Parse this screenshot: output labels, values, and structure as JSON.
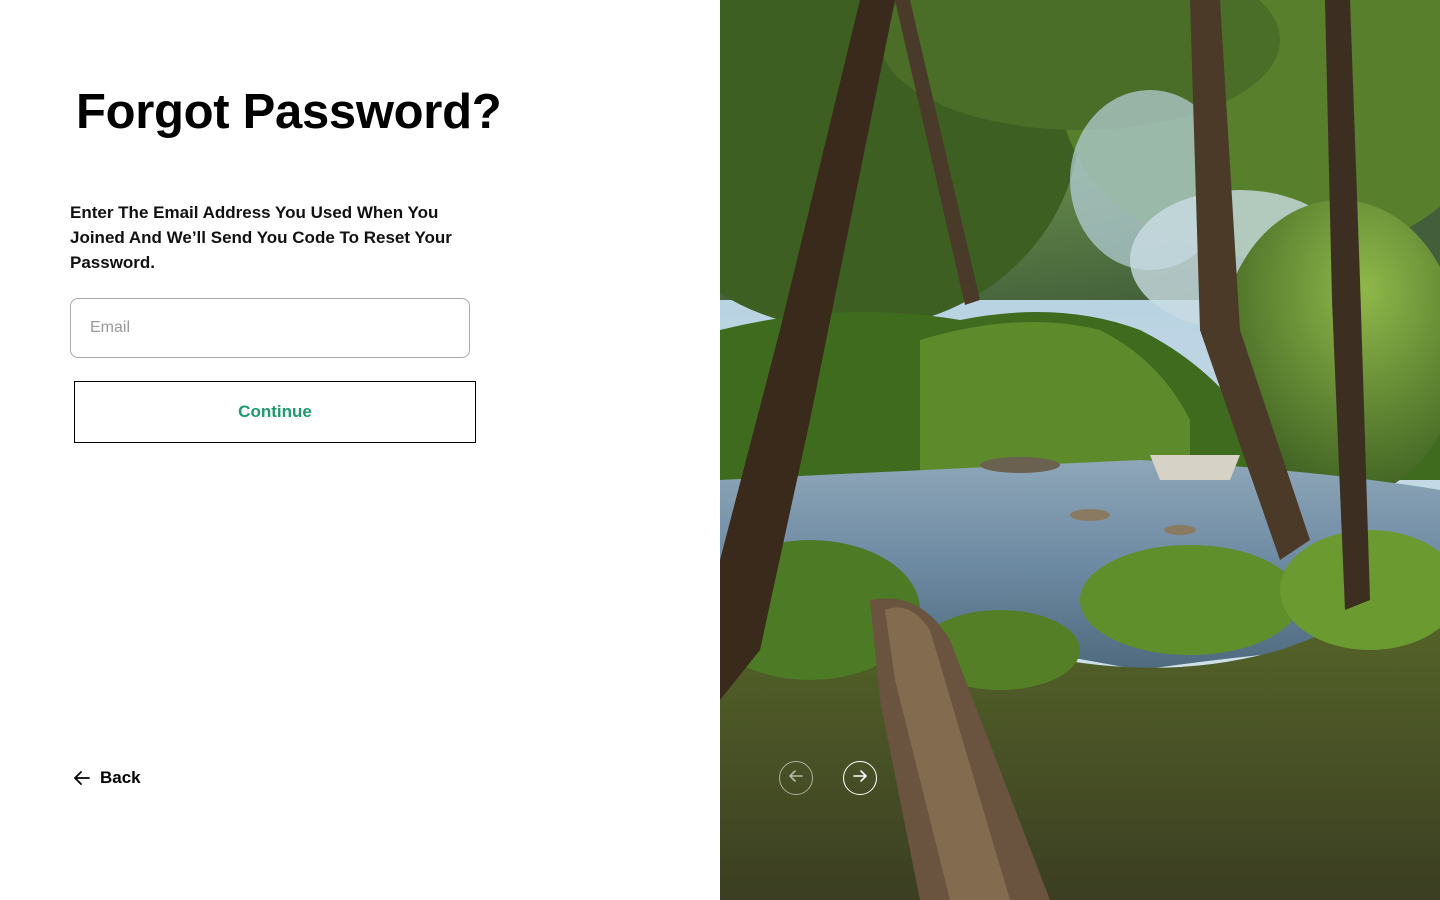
{
  "form": {
    "title": "Forgot Password?",
    "description": "Enter The Email Address You Used When You Joined And We’ll Send You Code To Reset Your Password.",
    "email_placeholder": "Email",
    "email_value": "",
    "continue_label": "Continue",
    "back_label": "Back"
  },
  "colors": {
    "accent": "#1f9a6e",
    "text": "#000000",
    "input_border": "#a9a9a9"
  },
  "carousel": {
    "image_description": "forest-river-photo",
    "prev_icon": "arrow-left-circle-icon",
    "next_icon": "arrow-right-circle-icon"
  }
}
